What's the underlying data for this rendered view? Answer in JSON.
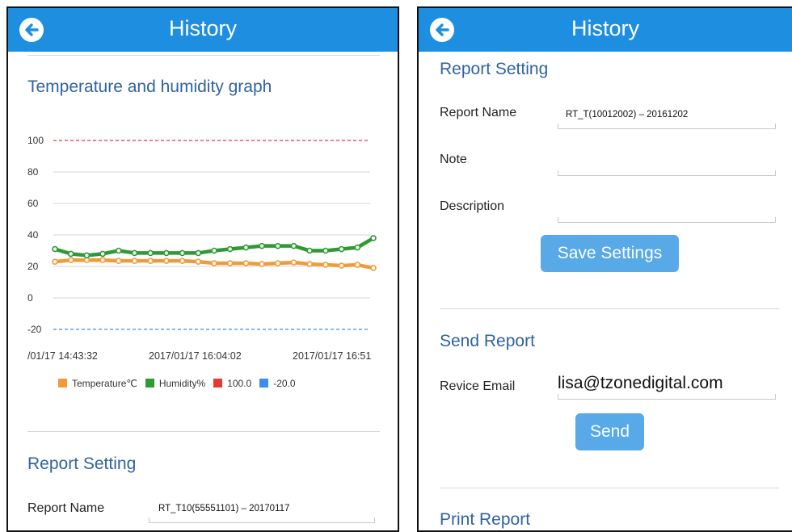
{
  "left": {
    "header_title": "History",
    "graph_title": "Temperature and humidity graph",
    "report_setting_title": "Report Setting",
    "report_name_label": "Report Name",
    "report_name_value": "RT_T10(55551101) – 20170117"
  },
  "right": {
    "header_title": "History",
    "report_setting_title": "Report Setting",
    "report_name_label": "Report Name",
    "report_name_value": "RT_T(10012002) – 20161202",
    "note_label": "Note",
    "note_value": "",
    "description_label": "Description",
    "description_value": "",
    "save_button": "Save Settings",
    "send_report_title": "Send Report",
    "email_label": "Revice Email",
    "email_value": "lisa@tzonedigital.com",
    "send_button": "Send",
    "print_report_title": "Print Report"
  },
  "chart_data": {
    "type": "line",
    "ylim": [
      -20,
      100
    ],
    "y_ticks": [
      "100",
      "80",
      "60",
      "40",
      "20",
      "0",
      "-20"
    ],
    "x_tick_labels": [
      "/01/17 14:43:32",
      "2017/01/17 16:04:02",
      "2017/01/17 16:51"
    ],
    "x": [
      0,
      1,
      2,
      3,
      4,
      5,
      6,
      7,
      8,
      9,
      10,
      11,
      12,
      13,
      14,
      15,
      16,
      17,
      18,
      19,
      20
    ],
    "series": [
      {
        "name": "Temperature℃",
        "color": "#f39a38",
        "values": [
          23,
          24,
          24,
          24,
          23.5,
          23.5,
          23.5,
          23.5,
          23.5,
          23,
          22,
          22,
          22,
          21.5,
          22,
          22.5,
          21.5,
          21,
          20.5,
          21,
          19
        ]
      },
      {
        "name": "Humidity%",
        "color": "#2e9a34",
        "values": [
          31,
          28,
          27,
          28,
          30,
          28.5,
          28.5,
          28.5,
          28.5,
          28.5,
          30,
          31,
          32,
          33,
          33,
          33,
          30,
          30,
          31,
          32,
          38
        ]
      },
      {
        "name": "100.0",
        "color": "#e53935",
        "values": [
          100,
          100
        ]
      },
      {
        "name": "-20.0",
        "color": "#3d8ee6",
        "values": [
          -20,
          -20
        ]
      }
    ],
    "grid": true,
    "legend_position": "bottom"
  }
}
